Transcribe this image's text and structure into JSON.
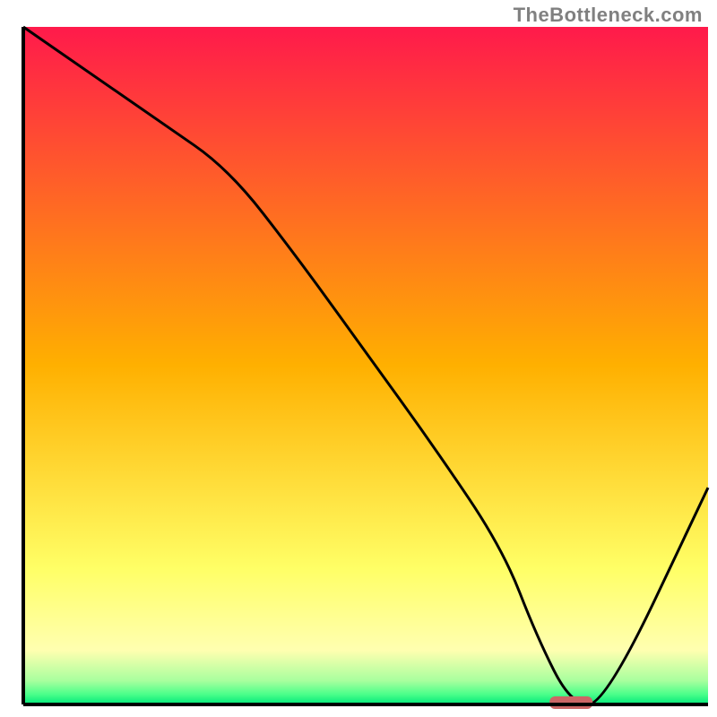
{
  "watermark": "TheBottleneck.com",
  "chart_data": {
    "type": "line",
    "title": "",
    "xlabel": "",
    "ylabel": "",
    "xlim": [
      0,
      100
    ],
    "ylim": [
      0,
      100
    ],
    "x": [
      0,
      10,
      20,
      30,
      40,
      50,
      60,
      70,
      75,
      80,
      85,
      100
    ],
    "values": [
      100,
      93,
      86,
      79,
      66,
      52,
      38,
      23,
      10,
      0,
      0,
      32
    ],
    "marker": {
      "x": 80,
      "y": 0
    },
    "gradient_stops": [
      {
        "offset": 0.0,
        "color": "#ff1a4b"
      },
      {
        "offset": 0.5,
        "color": "#ffb000"
      },
      {
        "offset": 0.8,
        "color": "#ffff66"
      },
      {
        "offset": 0.92,
        "color": "#ffffb0"
      },
      {
        "offset": 0.965,
        "color": "#a8ff9e"
      },
      {
        "offset": 0.985,
        "color": "#4bff8a"
      },
      {
        "offset": 1.0,
        "color": "#00e87a"
      }
    ],
    "marker_color": "#cc6666",
    "curve_color": "#000000",
    "axis_color": "#000000"
  }
}
